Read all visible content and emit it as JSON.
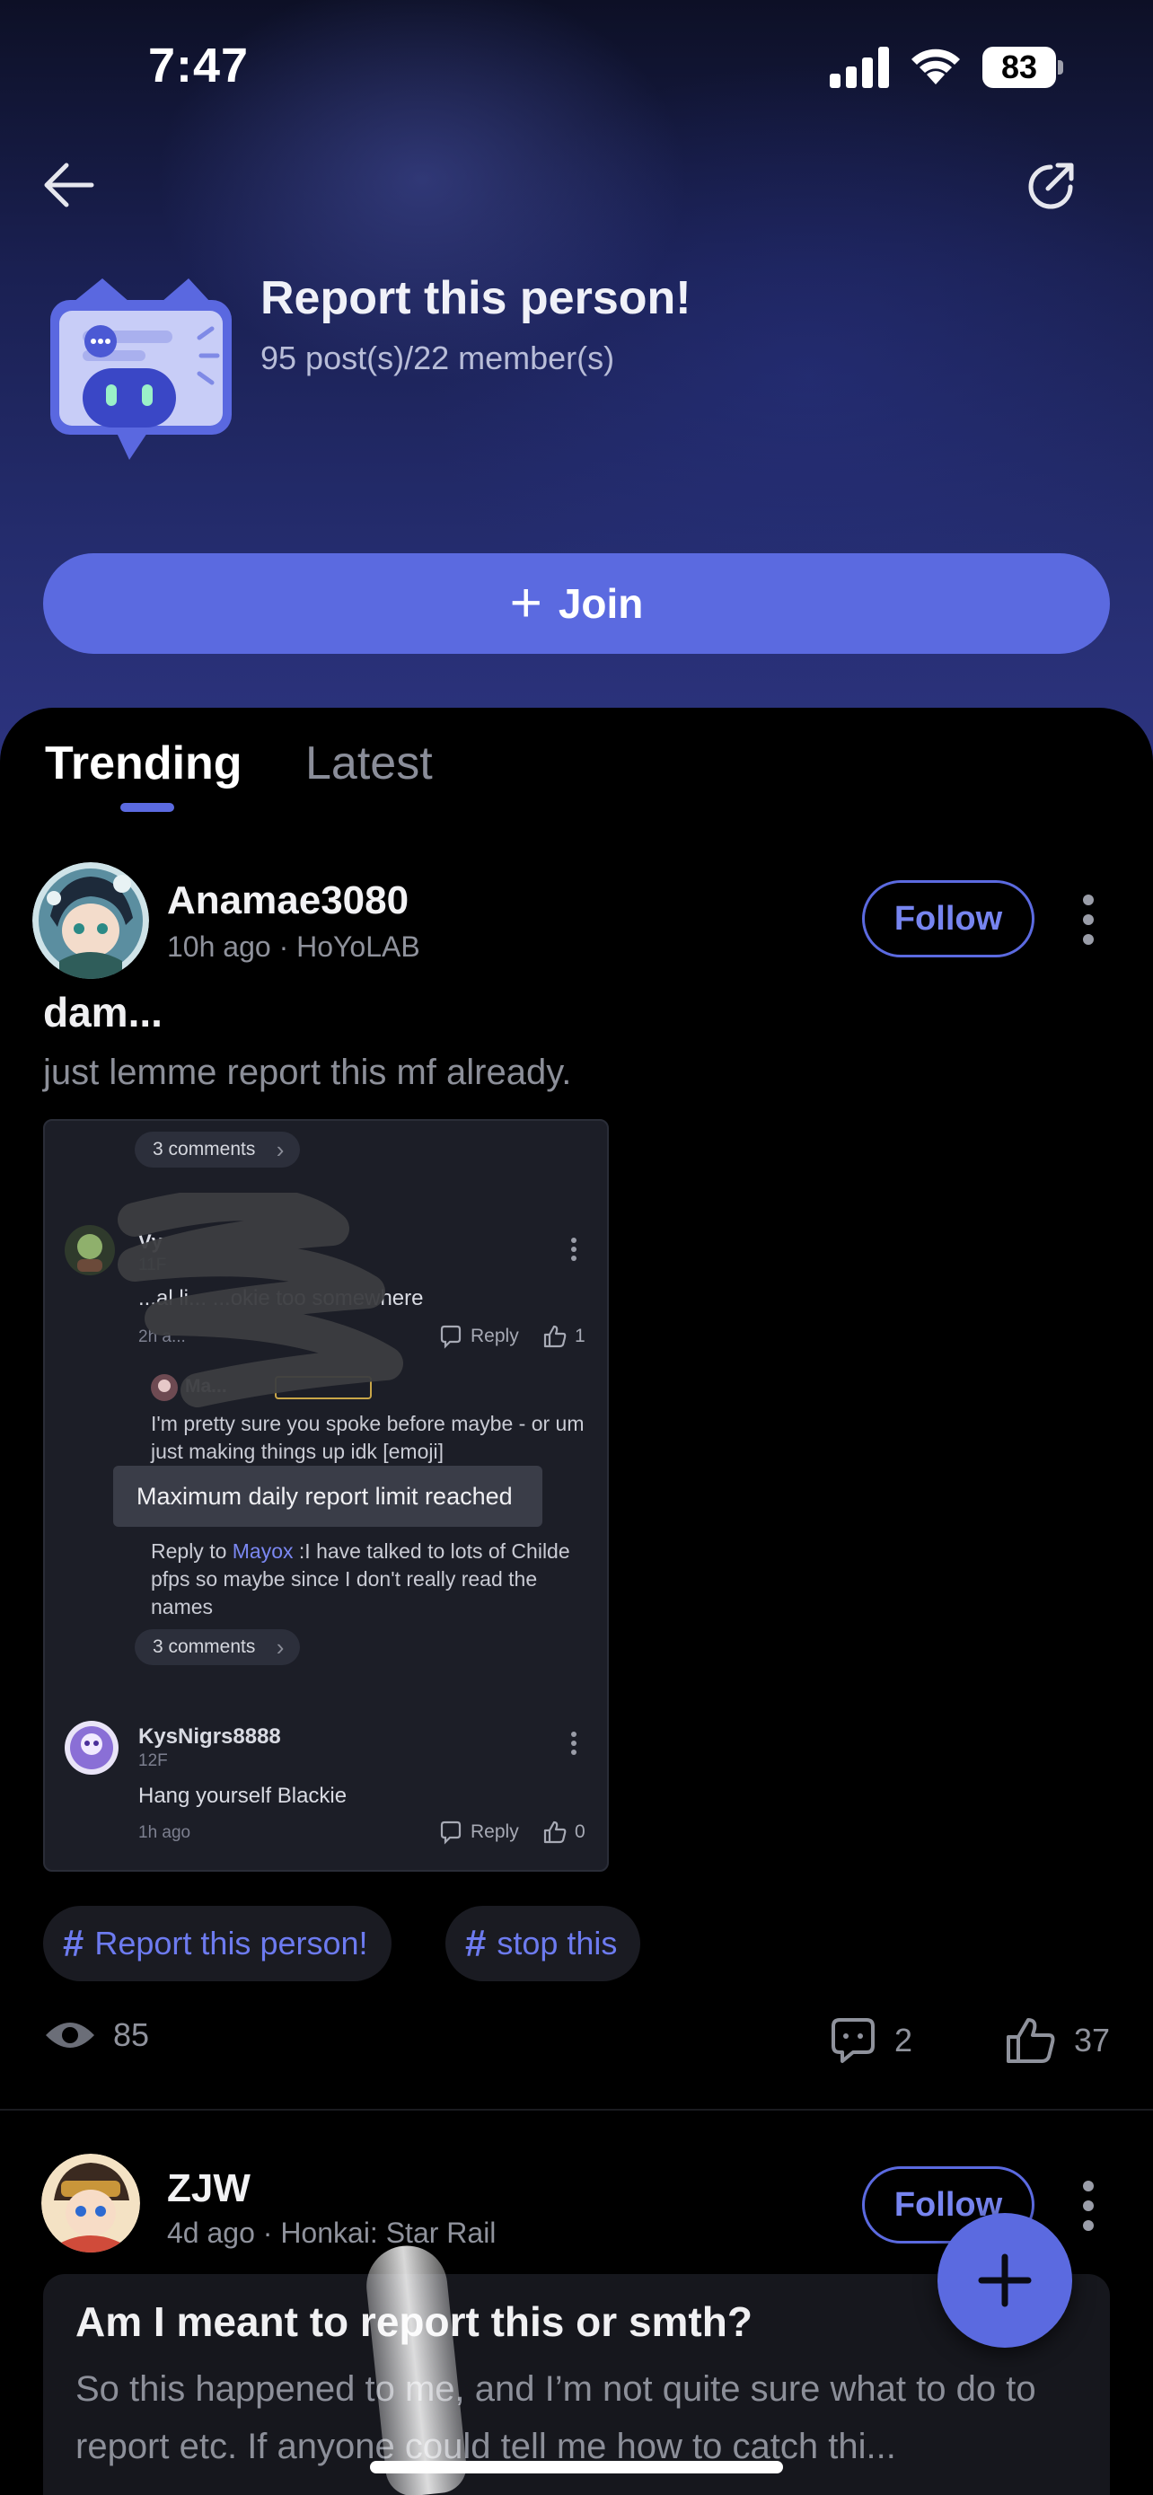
{
  "status_bar": {
    "time": "7:47",
    "battery": "83"
  },
  "group": {
    "name": "Report this person!",
    "stats": "95 post(s)/22 member(s)",
    "join_label": "Join"
  },
  "tabs": [
    {
      "label": "Trending",
      "active": true
    },
    {
      "label": "Latest",
      "active": false
    }
  ],
  "posts": [
    {
      "author": "Anamae3080",
      "meta": "10h ago · HoYoLAB",
      "follow_label": "Follow",
      "title": "dam...",
      "body": "just lemme report this mf already.",
      "screenshot": {
        "comments_pill_1": "3 comments",
        "comment_1_name": "Vу",
        "comment_1_floor": "11F",
        "comment_1_text": "...al li... ...okie too somewhere",
        "comment_1_time": "2h a...",
        "comment_1_reply": "Reply",
        "comment_1_likes": "1",
        "quote_name": "Ma...",
        "quote_text": "I'm pretty sure you spoke before maybe - or um just making things up idk [emoji]",
        "toast": "Maximum daily report limit reached",
        "reply_prefix": "Reply to ",
        "reply_mention": "Mayox",
        "reply_text": " :I have talked to lots of Childe pfps so maybe since I don't really read the names",
        "comments_pill_2": "3 comments",
        "comment_2_name": "KysNigrs8888",
        "comment_2_floor": "12F",
        "comment_2_text": "Hang yourself Blackie",
        "comment_2_time": "1h ago",
        "comment_2_reply": "Reply",
        "comment_2_likes": "0"
      },
      "tags": [
        "Report this person!",
        "stop this"
      ],
      "views": "85",
      "comments": "2",
      "likes": "37"
    },
    {
      "author": "ZJW",
      "meta": "4d ago · Honkai: Star Rail",
      "follow_label": "Follow",
      "title": "Am I meant to report this or smth?",
      "body": "So this happened to me, and I’m not quite sure what to do to report etc. If anyone could tell me how to catch thi..."
    }
  ],
  "colors": {
    "accent": "#5b6ae0",
    "background": "#000000",
    "hero_bottom": "#2d3480"
  },
  "icons": [
    "back-arrow-icon",
    "share-icon",
    "plus-icon",
    "more-vertical-icon",
    "hashtag-icon",
    "eye-icon",
    "comment-icon",
    "thumbs-up-icon"
  ]
}
